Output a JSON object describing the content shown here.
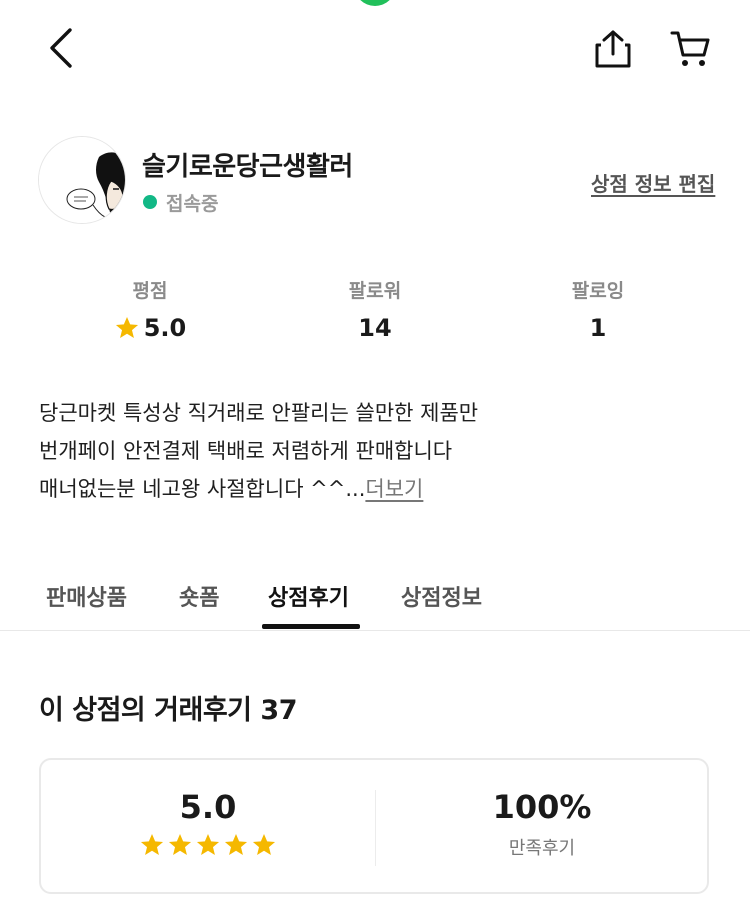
{
  "header": {
    "back_icon": "chevron-left-icon",
    "share_icon": "share-icon",
    "cart_icon": "cart-icon"
  },
  "profile": {
    "shop_name": "슬기로운당근생활러",
    "status": "접속중",
    "status_color": "#12b886",
    "edit_link": "상점 정보 편집"
  },
  "stats": {
    "rating_label": "평점",
    "rating_value": "5.0",
    "followers_label": "팔로워",
    "followers_value": "14",
    "following_label": "팔로잉",
    "following_value": "1"
  },
  "description": {
    "line1": "당근마켓 특성상 직거래로 안팔리는 쓸만한 제품만",
    "line2": "번개페이 안전결제 택배로 저렴하게 판매합니다",
    "line3": "매너없는분 네고왕 사절합니다 ^^...",
    "more": "더보기"
  },
  "tabs": [
    {
      "label": "판매상품"
    },
    {
      "label": "숏폼"
    },
    {
      "label": "상점후기"
    },
    {
      "label": "상점정보"
    }
  ],
  "active_tab": "상점후기",
  "reviews": {
    "title": "이 상점의 거래후기 37",
    "score": "5.0",
    "stars": 5,
    "satisfaction": "100%",
    "satisfaction_label": "만족후기"
  },
  "colors": {
    "accent_green": "#21c05b",
    "star": "#f5b800"
  }
}
